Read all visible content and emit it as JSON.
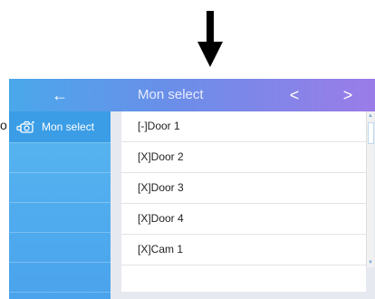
{
  "header": {
    "back_glyph": "←",
    "title": "Mon select",
    "prev_glyph": "<",
    "next_glyph": ">"
  },
  "sidebar": {
    "items": [
      {
        "label": "Mon select",
        "icon": "camera-icon",
        "active": true
      }
    ]
  },
  "list": {
    "rows": [
      {
        "label": "[-]Door 1"
      },
      {
        "label": "[X]Door 2"
      },
      {
        "label": "[X]Door 3"
      },
      {
        "label": "[X]Door 4"
      },
      {
        "label": "[X]Cam 1"
      }
    ]
  },
  "scroll": {
    "up_glyph": "▲",
    "down_glyph": "▼"
  },
  "edge_text": "o",
  "colors": {
    "topbar_start": "#4aa8ea",
    "topbar_end": "#9b7ce8",
    "sidebar": "#4aa3ec",
    "sidebar_active": "#3a9de6",
    "content_bg": "#e6e9ef"
  }
}
